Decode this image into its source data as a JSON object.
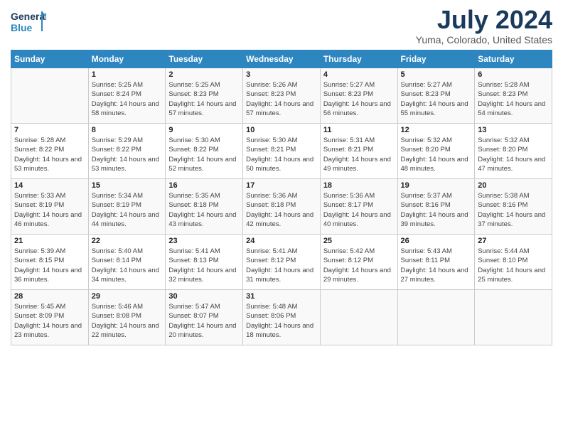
{
  "header": {
    "logo_line1": "General",
    "logo_line2": "Blue",
    "month_title": "July 2024",
    "subtitle": "Yuma, Colorado, United States"
  },
  "weekdays": [
    "Sunday",
    "Monday",
    "Tuesday",
    "Wednesday",
    "Thursday",
    "Friday",
    "Saturday"
  ],
  "weeks": [
    [
      {
        "day": "",
        "sunrise": "",
        "sunset": "",
        "daylight": ""
      },
      {
        "day": "1",
        "sunrise": "Sunrise: 5:25 AM",
        "sunset": "Sunset: 8:24 PM",
        "daylight": "Daylight: 14 hours and 58 minutes."
      },
      {
        "day": "2",
        "sunrise": "Sunrise: 5:25 AM",
        "sunset": "Sunset: 8:23 PM",
        "daylight": "Daylight: 14 hours and 57 minutes."
      },
      {
        "day": "3",
        "sunrise": "Sunrise: 5:26 AM",
        "sunset": "Sunset: 8:23 PM",
        "daylight": "Daylight: 14 hours and 57 minutes."
      },
      {
        "day": "4",
        "sunrise": "Sunrise: 5:27 AM",
        "sunset": "Sunset: 8:23 PM",
        "daylight": "Daylight: 14 hours and 56 minutes."
      },
      {
        "day": "5",
        "sunrise": "Sunrise: 5:27 AM",
        "sunset": "Sunset: 8:23 PM",
        "daylight": "Daylight: 14 hours and 55 minutes."
      },
      {
        "day": "6",
        "sunrise": "Sunrise: 5:28 AM",
        "sunset": "Sunset: 8:23 PM",
        "daylight": "Daylight: 14 hours and 54 minutes."
      }
    ],
    [
      {
        "day": "7",
        "sunrise": "Sunrise: 5:28 AM",
        "sunset": "Sunset: 8:22 PM",
        "daylight": "Daylight: 14 hours and 53 minutes."
      },
      {
        "day": "8",
        "sunrise": "Sunrise: 5:29 AM",
        "sunset": "Sunset: 8:22 PM",
        "daylight": "Daylight: 14 hours and 53 minutes."
      },
      {
        "day": "9",
        "sunrise": "Sunrise: 5:30 AM",
        "sunset": "Sunset: 8:22 PM",
        "daylight": "Daylight: 14 hours and 52 minutes."
      },
      {
        "day": "10",
        "sunrise": "Sunrise: 5:30 AM",
        "sunset": "Sunset: 8:21 PM",
        "daylight": "Daylight: 14 hours and 50 minutes."
      },
      {
        "day": "11",
        "sunrise": "Sunrise: 5:31 AM",
        "sunset": "Sunset: 8:21 PM",
        "daylight": "Daylight: 14 hours and 49 minutes."
      },
      {
        "day": "12",
        "sunrise": "Sunrise: 5:32 AM",
        "sunset": "Sunset: 8:20 PM",
        "daylight": "Daylight: 14 hours and 48 minutes."
      },
      {
        "day": "13",
        "sunrise": "Sunrise: 5:32 AM",
        "sunset": "Sunset: 8:20 PM",
        "daylight": "Daylight: 14 hours and 47 minutes."
      }
    ],
    [
      {
        "day": "14",
        "sunrise": "Sunrise: 5:33 AM",
        "sunset": "Sunset: 8:19 PM",
        "daylight": "Daylight: 14 hours and 46 minutes."
      },
      {
        "day": "15",
        "sunrise": "Sunrise: 5:34 AM",
        "sunset": "Sunset: 8:19 PM",
        "daylight": "Daylight: 14 hours and 44 minutes."
      },
      {
        "day": "16",
        "sunrise": "Sunrise: 5:35 AM",
        "sunset": "Sunset: 8:18 PM",
        "daylight": "Daylight: 14 hours and 43 minutes."
      },
      {
        "day": "17",
        "sunrise": "Sunrise: 5:36 AM",
        "sunset": "Sunset: 8:18 PM",
        "daylight": "Daylight: 14 hours and 42 minutes."
      },
      {
        "day": "18",
        "sunrise": "Sunrise: 5:36 AM",
        "sunset": "Sunset: 8:17 PM",
        "daylight": "Daylight: 14 hours and 40 minutes."
      },
      {
        "day": "19",
        "sunrise": "Sunrise: 5:37 AM",
        "sunset": "Sunset: 8:16 PM",
        "daylight": "Daylight: 14 hours and 39 minutes."
      },
      {
        "day": "20",
        "sunrise": "Sunrise: 5:38 AM",
        "sunset": "Sunset: 8:16 PM",
        "daylight": "Daylight: 14 hours and 37 minutes."
      }
    ],
    [
      {
        "day": "21",
        "sunrise": "Sunrise: 5:39 AM",
        "sunset": "Sunset: 8:15 PM",
        "daylight": "Daylight: 14 hours and 36 minutes."
      },
      {
        "day": "22",
        "sunrise": "Sunrise: 5:40 AM",
        "sunset": "Sunset: 8:14 PM",
        "daylight": "Daylight: 14 hours and 34 minutes."
      },
      {
        "day": "23",
        "sunrise": "Sunrise: 5:41 AM",
        "sunset": "Sunset: 8:13 PM",
        "daylight": "Daylight: 14 hours and 32 minutes."
      },
      {
        "day": "24",
        "sunrise": "Sunrise: 5:41 AM",
        "sunset": "Sunset: 8:12 PM",
        "daylight": "Daylight: 14 hours and 31 minutes."
      },
      {
        "day": "25",
        "sunrise": "Sunrise: 5:42 AM",
        "sunset": "Sunset: 8:12 PM",
        "daylight": "Daylight: 14 hours and 29 minutes."
      },
      {
        "day": "26",
        "sunrise": "Sunrise: 5:43 AM",
        "sunset": "Sunset: 8:11 PM",
        "daylight": "Daylight: 14 hours and 27 minutes."
      },
      {
        "day": "27",
        "sunrise": "Sunrise: 5:44 AM",
        "sunset": "Sunset: 8:10 PM",
        "daylight": "Daylight: 14 hours and 25 minutes."
      }
    ],
    [
      {
        "day": "28",
        "sunrise": "Sunrise: 5:45 AM",
        "sunset": "Sunset: 8:09 PM",
        "daylight": "Daylight: 14 hours and 23 minutes."
      },
      {
        "day": "29",
        "sunrise": "Sunrise: 5:46 AM",
        "sunset": "Sunset: 8:08 PM",
        "daylight": "Daylight: 14 hours and 22 minutes."
      },
      {
        "day": "30",
        "sunrise": "Sunrise: 5:47 AM",
        "sunset": "Sunset: 8:07 PM",
        "daylight": "Daylight: 14 hours and 20 minutes."
      },
      {
        "day": "31",
        "sunrise": "Sunrise: 5:48 AM",
        "sunset": "Sunset: 8:06 PM",
        "daylight": "Daylight: 14 hours and 18 minutes."
      },
      {
        "day": "",
        "sunrise": "",
        "sunset": "",
        "daylight": ""
      },
      {
        "day": "",
        "sunrise": "",
        "sunset": "",
        "daylight": ""
      },
      {
        "day": "",
        "sunrise": "",
        "sunset": "",
        "daylight": ""
      }
    ]
  ]
}
